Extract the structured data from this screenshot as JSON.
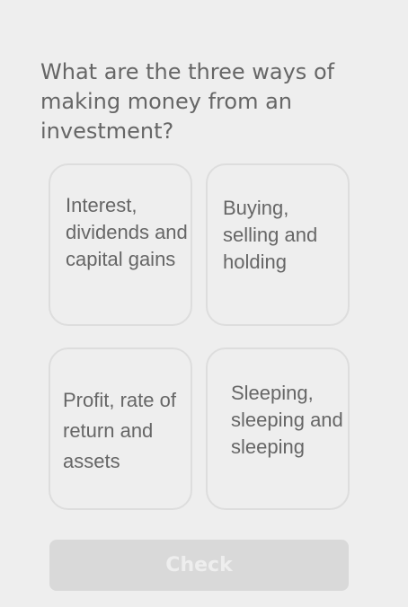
{
  "quiz": {
    "question": "What are the three ways of making money from an investment?",
    "options": [
      {
        "label": "Interest, dividends and capital gains"
      },
      {
        "label": "Buying, selling and holding"
      },
      {
        "label": "Profit, rate of return and assets"
      },
      {
        "label": "Sleeping, sleeping and sleeping"
      }
    ],
    "check_label": "Check"
  },
  "colors": {
    "background": "#eeeeee",
    "text": "#666666",
    "card_border": "#dddddd",
    "button_disabled": "#d9d9d9"
  }
}
